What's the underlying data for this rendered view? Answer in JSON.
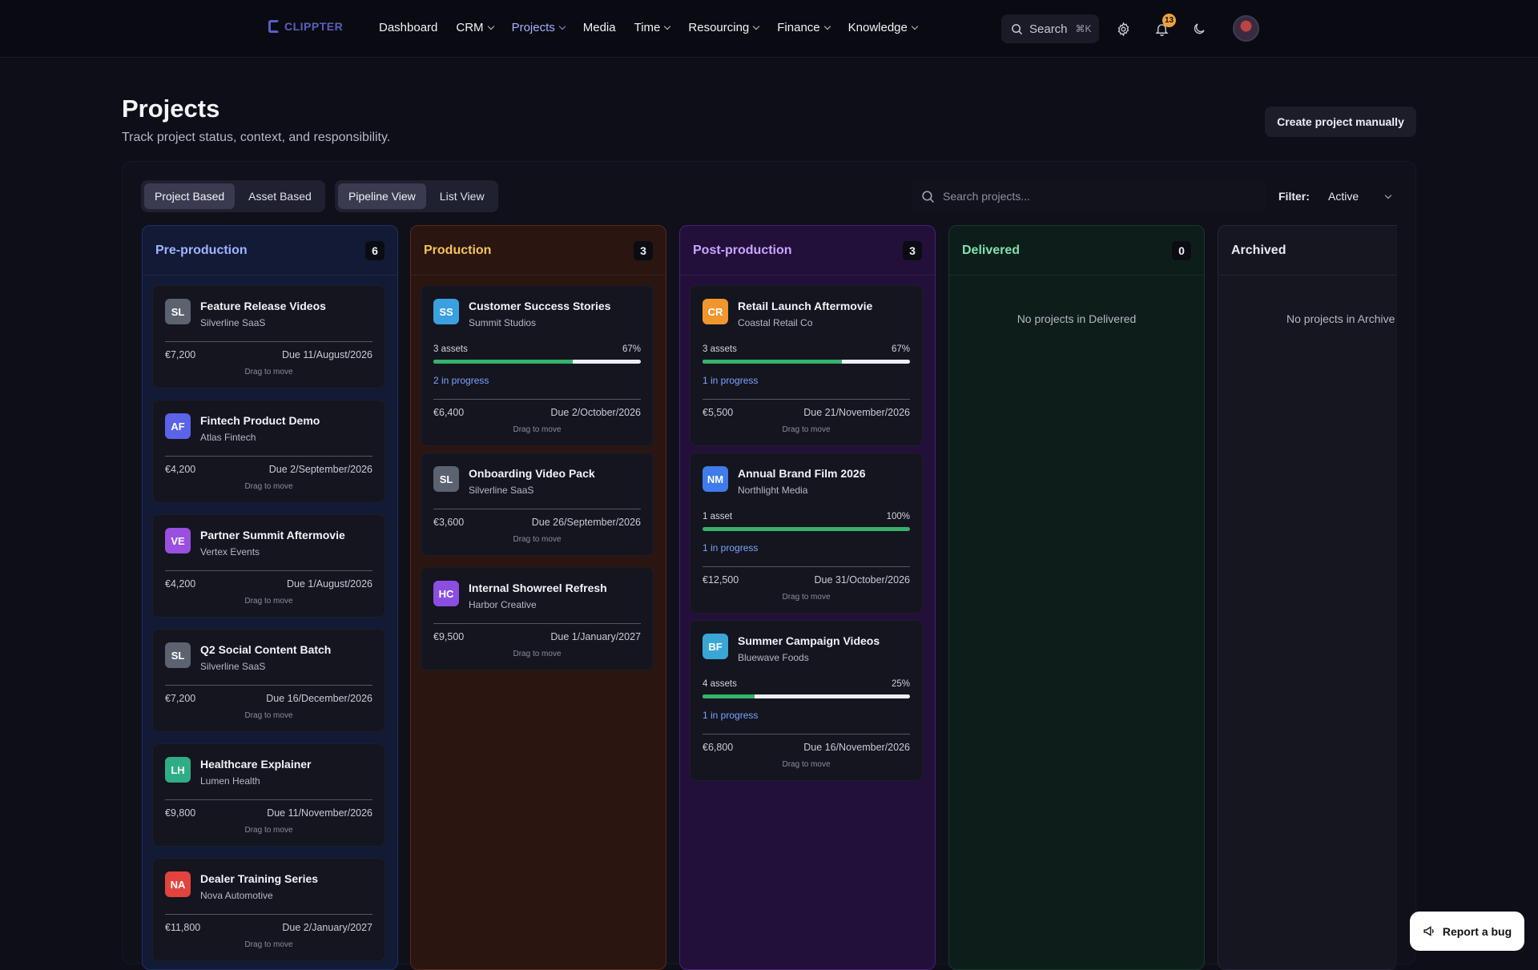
{
  "topbar": {
    "logo_text": "CLIPPTER",
    "nav": [
      {
        "label": "Dashboard",
        "dropdown": false,
        "active": false
      },
      {
        "label": "CRM",
        "dropdown": true,
        "active": false
      },
      {
        "label": "Projects",
        "dropdown": true,
        "active": true
      },
      {
        "label": "Media",
        "dropdown": false,
        "active": false
      },
      {
        "label": "Time",
        "dropdown": true,
        "active": false
      },
      {
        "label": "Resourcing",
        "dropdown": true,
        "active": false
      },
      {
        "label": "Finance",
        "dropdown": true,
        "active": false
      },
      {
        "label": "Knowledge",
        "dropdown": true,
        "active": false
      }
    ],
    "search_label": "Search",
    "search_shortcut": "⌘K",
    "notification_count": "13",
    "icons": [
      "search-icon",
      "gear-icon",
      "bell-icon",
      "moon-icon"
    ]
  },
  "page": {
    "title": "Projects",
    "subtitle": "Track project status, context, and responsibility.",
    "create_button": "Create project manually"
  },
  "toolbar": {
    "mode_tabs": [
      {
        "label": "Project Based",
        "active": true
      },
      {
        "label": "Asset Based",
        "active": false
      }
    ],
    "view_tabs": [
      {
        "label": "Pipeline View",
        "active": true
      },
      {
        "label": "List View",
        "active": false
      }
    ],
    "search_placeholder": "Search projects...",
    "filter_label": "Filter:",
    "filter_value": "Active"
  },
  "colors": {
    "accent": "#a9adff",
    "progress": "#34b36a",
    "in_progress_text": "#7aa4ff"
  },
  "columns": [
    {
      "title": "Pre-production",
      "count": "6",
      "title_color": "#9fb4ff",
      "bg": "#121a35",
      "border": "#1f2f66",
      "empty": "",
      "cards": [
        {
          "initials": "SL",
          "av_color": "#5b6270",
          "title": "Feature Release Videos",
          "client": "Silverline SaaS",
          "amount": "€7,200",
          "due": "Due 11/August/2026",
          "drag": "Drag to move"
        },
        {
          "initials": "AF",
          "av_color": "#5b63e8",
          "title": "Fintech Product Demo",
          "client": "Atlas Fintech",
          "amount": "€4,200",
          "due": "Due 2/September/2026",
          "drag": "Drag to move"
        },
        {
          "initials": "VE",
          "av_color": "#9a4fe0",
          "title": "Partner Summit Aftermovie",
          "client": "Vertex Events",
          "amount": "€4,200",
          "due": "Due 1/August/2026",
          "drag": "Drag to move"
        },
        {
          "initials": "SL",
          "av_color": "#5b6270",
          "title": "Q2 Social Content Batch",
          "client": "Silverline SaaS",
          "amount": "€7,200",
          "due": "Due 16/December/2026",
          "drag": "Drag to move"
        },
        {
          "initials": "LH",
          "av_color": "#2fae86",
          "title": "Healthcare Explainer",
          "client": "Lumen Health",
          "amount": "€9,800",
          "due": "Due 11/November/2026",
          "drag": "Drag to move"
        },
        {
          "initials": "NA",
          "av_color": "#e0443d",
          "title": "Dealer Training Series",
          "client": "Nova Automotive",
          "amount": "€11,800",
          "due": "Due 2/January/2027",
          "drag": "Drag to move"
        }
      ]
    },
    {
      "title": "Production",
      "count": "3",
      "title_color": "#f3c35c",
      "bg": "#2a1510",
      "border": "#5a2a16",
      "empty": "",
      "cards": [
        {
          "initials": "SS",
          "av_color": "#3aa0e0",
          "title": "Customer Success Stories",
          "client": "Summit Studios",
          "assets": "3 assets",
          "percent": "67%",
          "progress": 0.67,
          "inprog": "2 in progress",
          "amount": "€6,400",
          "due": "Due 2/October/2026",
          "drag": "Drag to move"
        },
        {
          "initials": "SL",
          "av_color": "#5b6270",
          "title": "Onboarding Video Pack",
          "client": "Silverline SaaS",
          "amount": "€3,600",
          "due": "Due 26/September/2026",
          "drag": "Drag to move"
        },
        {
          "initials": "HC",
          "av_color": "#8a4fe0",
          "title": "Internal Showreel Refresh",
          "client": "Harbor Creative",
          "amount": "€9,500",
          "due": "Due 1/January/2027",
          "drag": "Drag to move"
        }
      ]
    },
    {
      "title": "Post-production",
      "count": "3",
      "title_color": "#c9a6ff",
      "bg": "#22103a",
      "border": "#43207a",
      "empty": "",
      "cards": [
        {
          "initials": "CR",
          "av_color": "#f0962e",
          "title": "Retail Launch Aftermovie",
          "client": "Coastal Retail Co",
          "assets": "3 assets",
          "percent": "67%",
          "progress": 0.67,
          "inprog": "1 in progress",
          "amount": "€5,500",
          "due": "Due 21/November/2026",
          "drag": "Drag to move"
        },
        {
          "initials": "NM",
          "av_color": "#3f7bea",
          "title": "Annual Brand Film 2026",
          "client": "Northlight Media",
          "assets": "1 asset",
          "percent": "100%",
          "progress": 1.0,
          "inprog": "1 in progress",
          "amount": "€12,500",
          "due": "Due 31/October/2026",
          "drag": "Drag to move"
        },
        {
          "initials": "BF",
          "av_color": "#3aa6d6",
          "title": "Summer Campaign Videos",
          "client": "Bluewave Foods",
          "assets": "4 assets",
          "percent": "25%",
          "progress": 0.25,
          "inprog": "1 in progress",
          "amount": "€6,800",
          "due": "Due 16/November/2026",
          "drag": "Drag to move"
        }
      ]
    },
    {
      "title": "Delivered",
      "count": "0",
      "title_color": "#7fe0b0",
      "bg": "#0d1e1a",
      "border": "#16392e",
      "empty": "No projects in Delivered",
      "cards": []
    },
    {
      "title": "Archived",
      "count": "",
      "title_color": "#e8e9ef",
      "bg": "#151620",
      "border": "#25263a",
      "empty": "No projects in Archive",
      "cards": []
    }
  ],
  "report_bug": "Report a bug"
}
